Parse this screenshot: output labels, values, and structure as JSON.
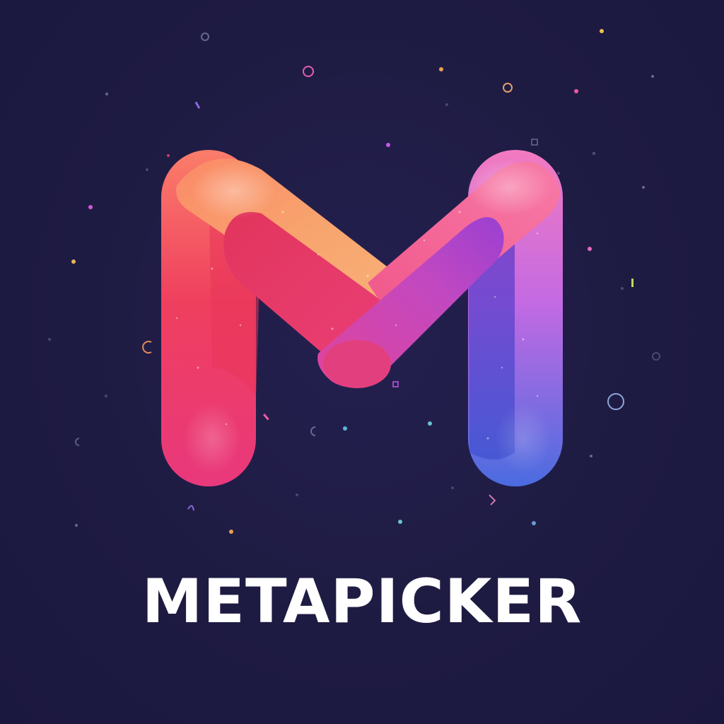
{
  "brand": {
    "name": "METAPICKER"
  },
  "colors": {
    "background": "#1e1b42",
    "gradient_orange": "#fb9a6a",
    "gradient_red": "#ef3f62",
    "gradient_pink": "#f45aa0",
    "gradient_magenta": "#d23c9a",
    "gradient_violet": "#7a43d8",
    "gradient_blue": "#4a5ad8",
    "text": "#ffffff"
  },
  "icons": {
    "logo": "letter-m-ribbon-logo-icon",
    "decoration": "confetti-particles-icon"
  }
}
